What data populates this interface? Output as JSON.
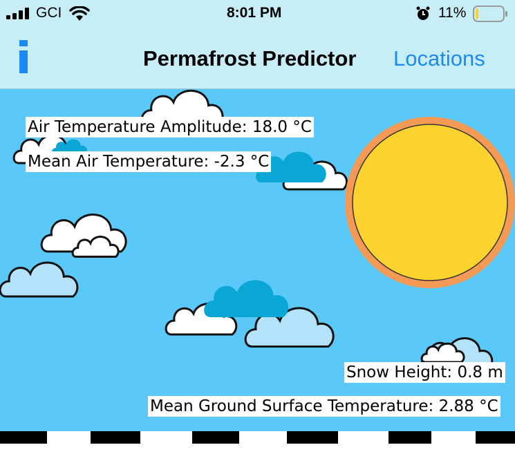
{
  "status_bar": {
    "carrier": "GCI",
    "time": "8:01 PM",
    "battery_percent": "11%",
    "battery_level": 0.11,
    "signal_icon": "cellular-signal-icon",
    "wifi_icon": "wifi-icon",
    "alarm_icon": "alarm-clock-icon",
    "battery_icon": "battery-icon"
  },
  "nav": {
    "info_label": "i",
    "title": "Permafrost Predictor",
    "locations_label": "Locations"
  },
  "scene": {
    "air_temp_amplitude": "Air Temperature Amplitude: 18.0 °C",
    "mean_air_temp": "Mean Air Temperature: -2.3 °C",
    "snow_height": "Snow Height: 0.8 m",
    "mean_ground_temp": "Mean Ground Surface Temperature: 2.88 °C"
  },
  "colors": {
    "sky": "#5ac8f9",
    "nav_background": "#c7eef7",
    "accent_blue": "#1b8af5",
    "sun_fill": "#fcd22e",
    "sun_ring": "#f59a55",
    "battery_low": "#fbd22e"
  }
}
